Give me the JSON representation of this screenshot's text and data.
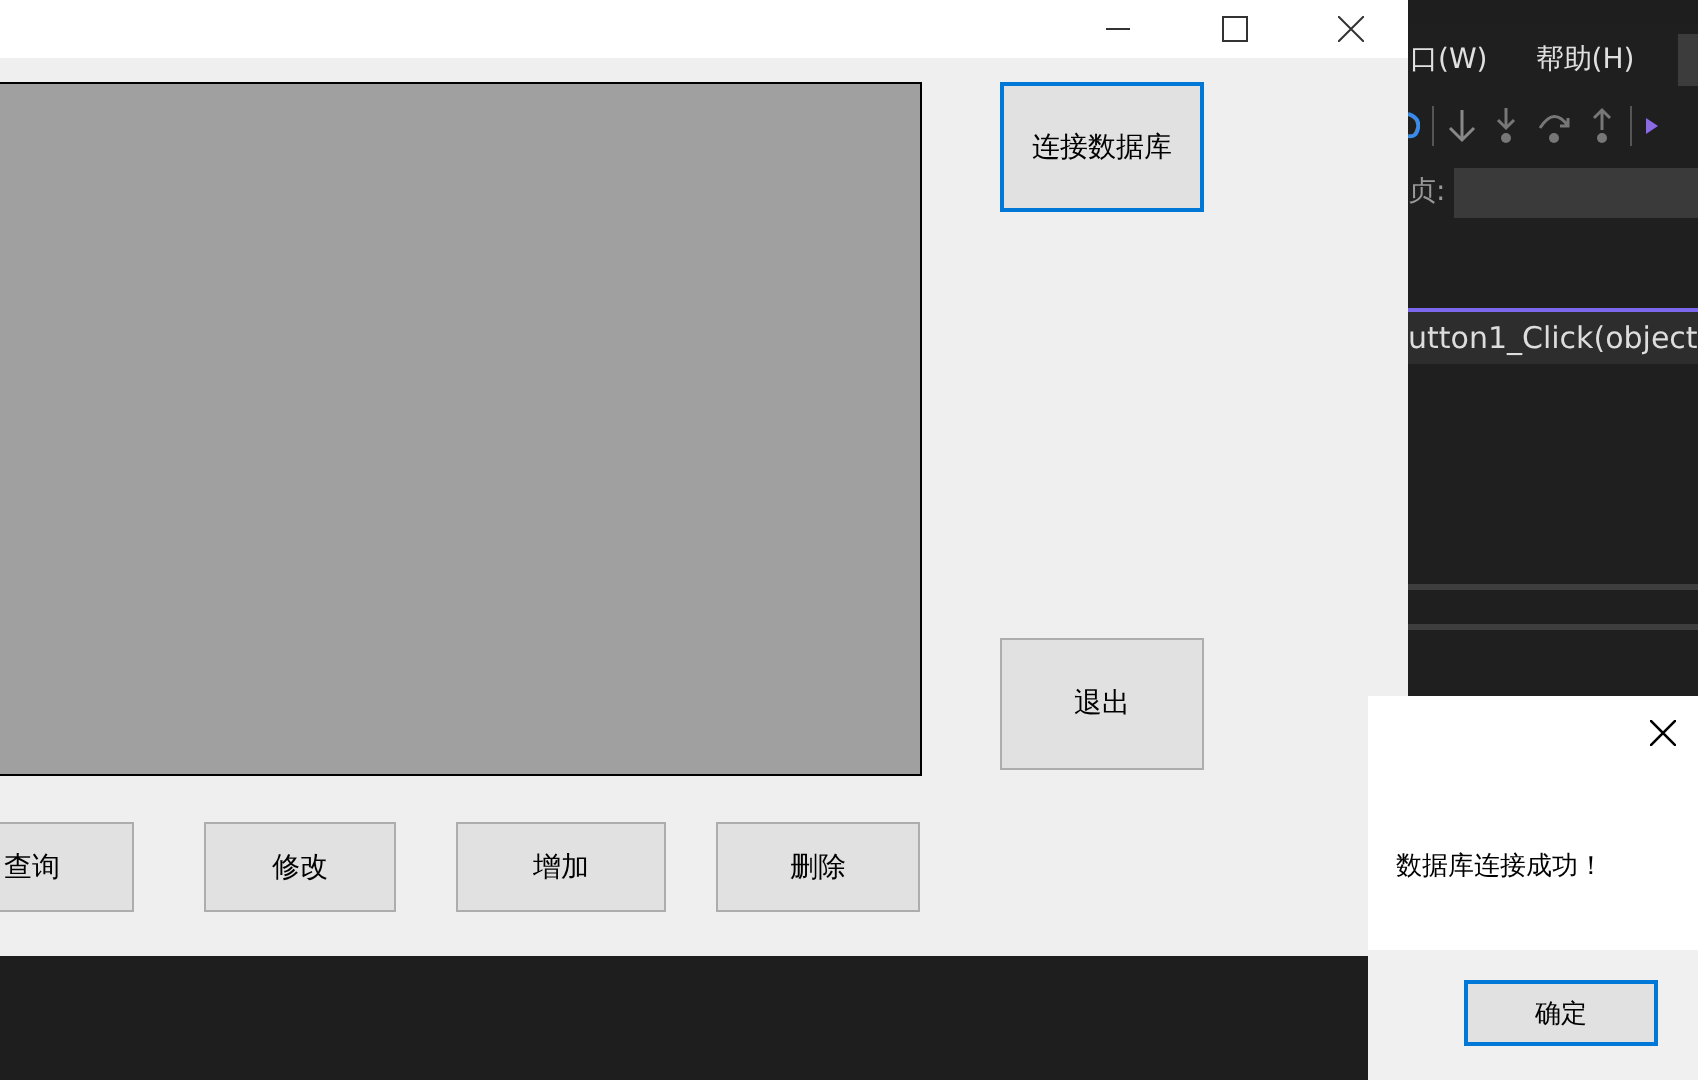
{
  "form_window": {
    "grid_buttons": [
      {
        "label": "查询",
        "focused": false
      },
      {
        "label": "修改",
        "focused": false
      },
      {
        "label": "增加",
        "focused": false
      },
      {
        "label": "删除",
        "focused": false
      }
    ],
    "side_buttons": [
      {
        "label": "连接数据库",
        "focused": true
      },
      {
        "label": "退出",
        "focused": false
      }
    ]
  },
  "ide": {
    "menu": [
      "口(W)",
      "帮助(H)"
    ],
    "field_label": "贞:",
    "editor_tab": "utton1_Click(object"
  },
  "message_box": {
    "message": "数据库连接成功！",
    "button": {
      "label": "确定",
      "focused": true
    }
  }
}
